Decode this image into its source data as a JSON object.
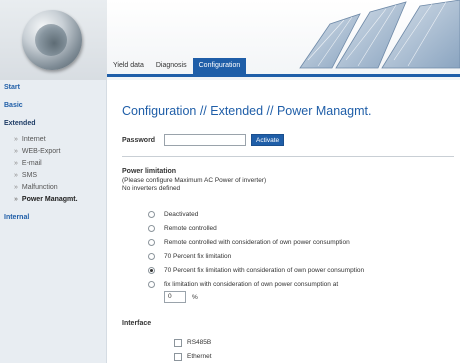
{
  "header": {
    "tabs": [
      {
        "label": "Yield data",
        "active": false
      },
      {
        "label": "Diagnosis",
        "active": false
      },
      {
        "label": "Configuration",
        "active": true
      }
    ],
    "accent_color": "#1f5ea8"
  },
  "sidebar": {
    "start": "Start",
    "basic": "Basic",
    "extended": "Extended",
    "items": [
      {
        "label": "Internet"
      },
      {
        "label": "WEB-Export"
      },
      {
        "label": "E-mail"
      },
      {
        "label": "SMS"
      },
      {
        "label": "Malfunction"
      },
      {
        "label": "Power Managmt."
      }
    ],
    "internal": "Internal"
  },
  "main": {
    "title": "Configuration // Extended // Power Managmt.",
    "password_label": "Password",
    "password_value": "",
    "activate_label": "Activate",
    "power_limitation": {
      "title": "Power limitation",
      "note": "(Please configure Maximum AC Power of inverter)",
      "status": "No inverters defined",
      "options": [
        {
          "label": "Deactivated",
          "selected": false
        },
        {
          "label": "Remote controlled",
          "selected": false
        },
        {
          "label": "Remote controlled with consideration of own power consumption",
          "selected": false
        },
        {
          "label": "70 Percent fix limitation",
          "selected": false
        },
        {
          "label": "70 Percent fix limitation with consideration of own power consumption",
          "selected": true
        },
        {
          "label": "fix limitation with consideration of own power consumption at",
          "selected": false
        }
      ],
      "percent_value": "0",
      "percent_unit": "%"
    },
    "interface": {
      "title": "Interface",
      "options": [
        {
          "label": "RS485B",
          "checked": false
        },
        {
          "label": "Ethernet",
          "checked": false
        }
      ]
    }
  }
}
